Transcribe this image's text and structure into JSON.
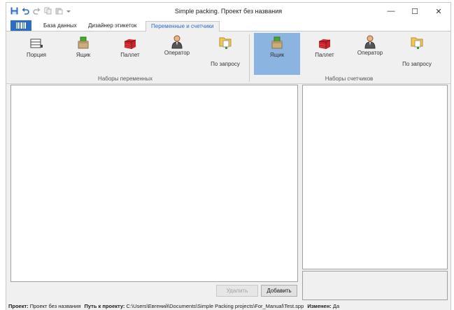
{
  "window": {
    "title": "Simple packing. Проект без названия",
    "controls": {
      "minimize": "—",
      "maximize": "☐",
      "close": "✕"
    }
  },
  "qat_icons": [
    "save-icon",
    "undo-icon",
    "redo-icon",
    "copy-icon",
    "paste-icon",
    "customize-dropdown-icon"
  ],
  "tabs": [
    {
      "label": "База данных",
      "active": false
    },
    {
      "label": "Дизайнер этикеток",
      "active": false
    },
    {
      "label": "Переменные и счетчики",
      "active": true
    }
  ],
  "ribbon": {
    "variables_group": {
      "label": "Наборы переменных",
      "buttons": [
        {
          "label": "Порция",
          "icon": "portion-icon"
        },
        {
          "label": "Ящик",
          "icon": "box-icon"
        },
        {
          "label": "Паллет",
          "icon": "pallet-icon"
        },
        {
          "label": "Оператор",
          "icon": "operator-icon"
        },
        {
          "label": "По запросу",
          "icon": "on-request-icon"
        }
      ]
    },
    "counters_group": {
      "label": "Наборы счетчиков",
      "buttons": [
        {
          "label": "Ящик",
          "icon": "box-icon",
          "selected": true
        },
        {
          "label": "Паллет",
          "icon": "pallet-icon"
        },
        {
          "label": "Оператор",
          "icon": "operator-icon"
        },
        {
          "label": "По запросу",
          "icon": "on-request-icon"
        }
      ]
    }
  },
  "actions": {
    "delete_label": "Удалить",
    "add_label": "Добавить"
  },
  "status": {
    "project_label": "Проект:",
    "project_value": "Проект без названия",
    "path_label": "Путь к проекту:",
    "path_value": "C:\\Users\\Евгений\\Documents\\Simple Packing projects\\For_Manual\\Test.spp",
    "changed_label": "Изменен:",
    "changed_value": "Да"
  },
  "colors": {
    "accent": "#2b6cc4",
    "selected": "#8cb4e0"
  }
}
